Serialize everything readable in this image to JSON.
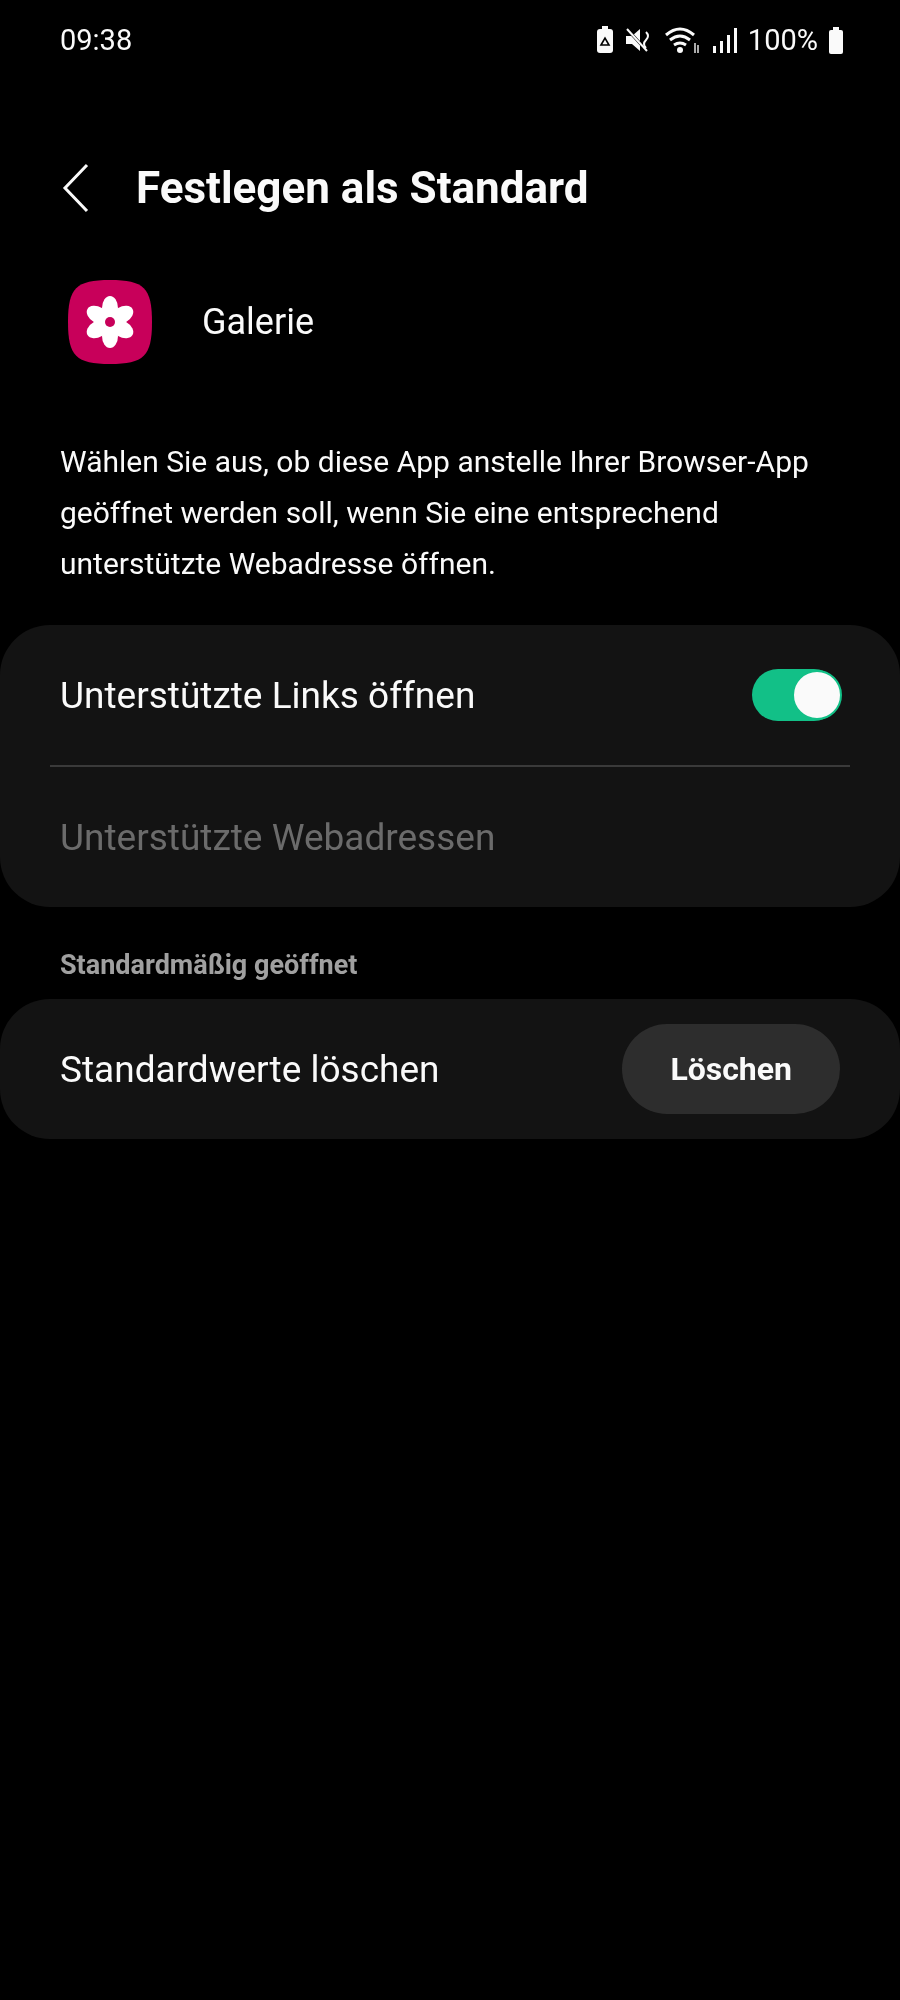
{
  "status_bar": {
    "time": "09:38",
    "battery": "100%"
  },
  "header": {
    "title": "Festlegen als Standard"
  },
  "app": {
    "name": "Galerie"
  },
  "description": "Wählen Sie aus, ob diese App anstelle Ihrer Browser-App geöffnet werden soll, wenn Sie eine entsprechend unterstützte Webadresse öffnen.",
  "links_card": [
    {
      "kind": "toggle",
      "label": "Unterstützte Links öffnen",
      "on": true,
      "disabled": false
    },
    {
      "kind": "plain",
      "label": "Unterstützte Webadressen",
      "disabled": true
    }
  ],
  "section_header": "Standardmäßig geöffnet",
  "defaults_card": {
    "label": "Standardwerte löschen",
    "button": "Löschen"
  }
}
